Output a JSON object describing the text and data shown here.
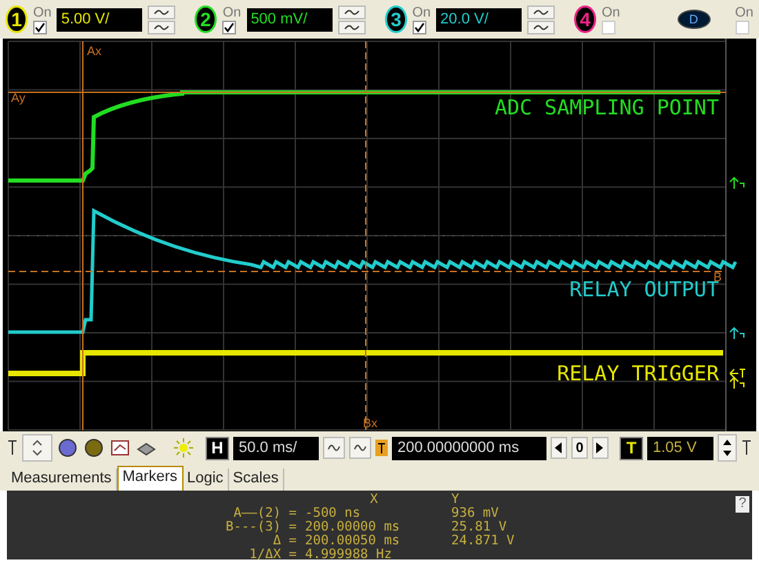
{
  "channels": [
    {
      "number": "1",
      "color": "#e6e600",
      "on_label": "On",
      "checked": true,
      "scale": "5.00 V/"
    },
    {
      "number": "2",
      "color": "#22dd22",
      "on_label": "On",
      "checked": true,
      "scale": "500 mV/"
    },
    {
      "number": "3",
      "color": "#22cccc",
      "on_label": "On",
      "checked": true,
      "scale": "20.0 V/"
    },
    {
      "number": "4",
      "color": "#ee2288",
      "on_label": "On",
      "checked": false
    }
  ],
  "digital": {
    "label": "D",
    "on_label": "On",
    "checked": false
  },
  "screen": {
    "labels": [
      {
        "text": "ADC SAMPLING POINT",
        "color": "#22dd22"
      },
      {
        "text": "RELAY OUTPUT",
        "color": "#22cccc"
      },
      {
        "text": "RELAY TRIGGER",
        "color": "#e6e600"
      }
    ],
    "markers": {
      "ax": "Ax",
      "ay": "Ay",
      "bx": "Bx",
      "by": "B"
    }
  },
  "controls": {
    "horizontal_label": "H",
    "timebase": "50.0 ms/",
    "delay": "200.00000000 ms",
    "delay_reset": "0",
    "trigger_label": "T",
    "trigger_level": "1.05 V"
  },
  "tabs": [
    {
      "label": "Measurements",
      "selected": false
    },
    {
      "label": "Markers",
      "selected": true
    },
    {
      "label": "Logic",
      "selected": false
    },
    {
      "label": "Scales",
      "selected": false
    }
  ],
  "markers_panel": {
    "x_header": "X",
    "y_header": "Y",
    "rows": [
      {
        "name": "A——(2) =",
        "x": "-500 ns",
        "y": "936 mV"
      },
      {
        "name": "B---(3) =",
        "x": "200.00000 ms",
        "y": "25.81 V"
      },
      {
        "name": "Δ =",
        "x": "200.00050 ms",
        "y": "24.871 V"
      },
      {
        "name": "1/ΔX =",
        "x": "4.999988 Hz"
      }
    ]
  },
  "help": "?"
}
